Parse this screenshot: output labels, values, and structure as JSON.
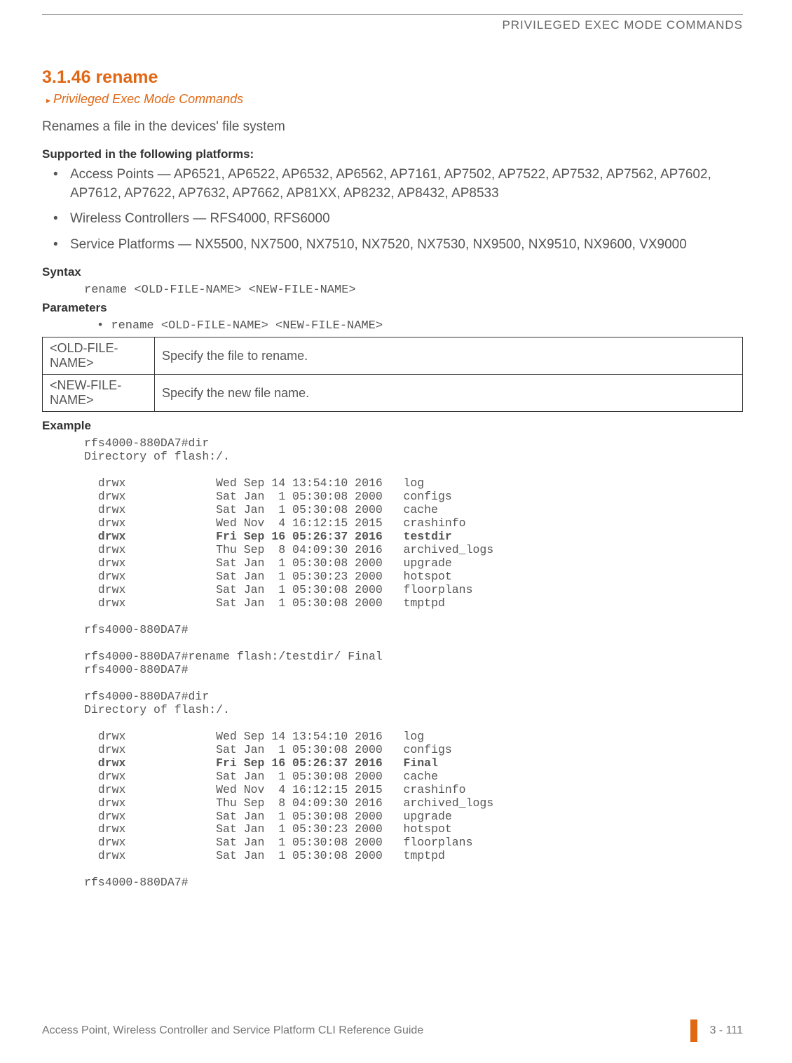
{
  "header": {
    "running_title": "PRIVILEGED EXEC MODE COMMANDS"
  },
  "section": {
    "number_title": "3.1.46 rename",
    "breadcrumb": "Privileged Exec Mode Commands",
    "description": "Renames a file in the devices' file system"
  },
  "platforms": {
    "heading": "Supported in the following platforms:",
    "items": [
      "Access Points — AP6521, AP6522, AP6532, AP6562, AP7161, AP7502, AP7522, AP7532, AP7562, AP7602, AP7612, AP7622, AP7632, AP7662, AP81XX, AP8232, AP8432, AP8533",
      "Wireless Controllers — RFS4000, RFS6000",
      "Service Platforms — NX5500, NX7500, NX7510, NX7520, NX7530, NX9500, NX9510, NX9600, VX9000"
    ]
  },
  "syntax": {
    "heading": "Syntax",
    "code": "rename <OLD-FILE-NAME> <NEW-FILE-NAME>"
  },
  "parameters": {
    "heading": "Parameters",
    "bullet": "• rename <OLD-FILE-NAME> <NEW-FILE-NAME>",
    "rows": [
      {
        "name": "<OLD-FILE-NAME>",
        "desc": "Specify the file to rename."
      },
      {
        "name": "<NEW-FILE-NAME>",
        "desc": "Specify the new file name."
      }
    ]
  },
  "example": {
    "heading": "Example",
    "lines": [
      {
        "t": "rfs4000-880DA7#dir",
        "b": false
      },
      {
        "t": "Directory of flash:/.",
        "b": false
      },
      {
        "t": "",
        "b": false
      },
      {
        "t": "  drwx             Wed Sep 14 13:54:10 2016   log",
        "b": false
      },
      {
        "t": "  drwx             Sat Jan  1 05:30:08 2000   configs",
        "b": false
      },
      {
        "t": "  drwx             Sat Jan  1 05:30:08 2000   cache",
        "b": false
      },
      {
        "t": "  drwx             Wed Nov  4 16:12:15 2015   crashinfo",
        "b": false
      },
      {
        "t": "  drwx             Fri Sep 16 05:26:37 2016   testdir",
        "b": true
      },
      {
        "t": "  drwx             Thu Sep  8 04:09:30 2016   archived_logs",
        "b": false
      },
      {
        "t": "  drwx             Sat Jan  1 05:30:08 2000   upgrade",
        "b": false
      },
      {
        "t": "  drwx             Sat Jan  1 05:30:23 2000   hotspot",
        "b": false
      },
      {
        "t": "  drwx             Sat Jan  1 05:30:08 2000   floorplans",
        "b": false
      },
      {
        "t": "  drwx             Sat Jan  1 05:30:08 2000   tmptpd",
        "b": false
      },
      {
        "t": "",
        "b": false
      },
      {
        "t": "rfs4000-880DA7#",
        "b": false
      },
      {
        "t": "",
        "b": false
      },
      {
        "t": "rfs4000-880DA7#rename flash:/testdir/ Final",
        "b": false
      },
      {
        "t": "rfs4000-880DA7#",
        "b": false
      },
      {
        "t": "",
        "b": false
      },
      {
        "t": "rfs4000-880DA7#dir",
        "b": false
      },
      {
        "t": "Directory of flash:/.",
        "b": false
      },
      {
        "t": "",
        "b": false
      },
      {
        "t": "  drwx             Wed Sep 14 13:54:10 2016   log",
        "b": false
      },
      {
        "t": "  drwx             Sat Jan  1 05:30:08 2000   configs",
        "b": false
      },
      {
        "t": "  drwx             Fri Sep 16 05:26:37 2016   Final",
        "b": true
      },
      {
        "t": "  drwx             Sat Jan  1 05:30:08 2000   cache",
        "b": false
      },
      {
        "t": "  drwx             Wed Nov  4 16:12:15 2015   crashinfo",
        "b": false
      },
      {
        "t": "  drwx             Thu Sep  8 04:09:30 2016   archived_logs",
        "b": false
      },
      {
        "t": "  drwx             Sat Jan  1 05:30:08 2000   upgrade",
        "b": false
      },
      {
        "t": "  drwx             Sat Jan  1 05:30:23 2000   hotspot",
        "b": false
      },
      {
        "t": "  drwx             Sat Jan  1 05:30:08 2000   floorplans",
        "b": false
      },
      {
        "t": "  drwx             Sat Jan  1 05:30:08 2000   tmptpd",
        "b": false
      },
      {
        "t": "",
        "b": false
      },
      {
        "t": "rfs4000-880DA7#",
        "b": false
      }
    ]
  },
  "footer": {
    "guide": "Access Point, Wireless Controller and Service Platform CLI Reference Guide",
    "page": "3 - 111"
  }
}
